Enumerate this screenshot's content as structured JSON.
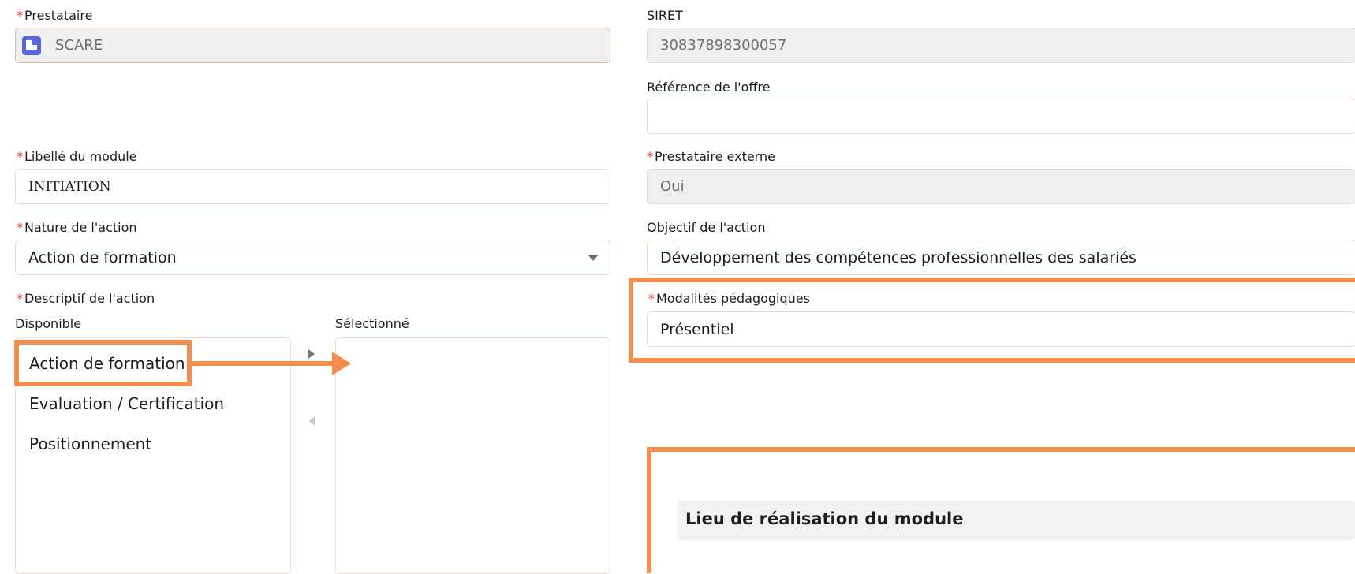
{
  "required_mark": "*",
  "prestataire": {
    "label": "Prestataire",
    "value": "SCARE",
    "icon": "building-icon"
  },
  "siret": {
    "label": "SIRET",
    "value": "30837898300057"
  },
  "reference_offre": {
    "label": "Référence de l'offre",
    "value": ""
  },
  "libelle_module": {
    "label": "Libellé du module",
    "value": "INITIATION"
  },
  "prestataire_externe": {
    "label": "Prestataire externe",
    "value": "Oui"
  },
  "nature_action": {
    "label": "Nature de l'action",
    "value": "Action de formation"
  },
  "objectif_action": {
    "label": "Objectif de l'action",
    "value": "Développement des compétences professionnelles des salariés"
  },
  "descriptif_action": {
    "label": "Descriptif de l'action",
    "available_label": "Disponible",
    "selected_label": "Sélectionné",
    "available": [
      "Action de formation",
      "Evaluation / Certification",
      "Positionnement"
    ],
    "selected": []
  },
  "modalites": {
    "label": "Modalités pédagogiques",
    "value": "Présentiel"
  },
  "lieu_section": {
    "title": "Lieu de réalisation du module"
  },
  "colors": {
    "highlight": "#f58d4c",
    "required": "#e5322d",
    "icon_bg": "#5868d9"
  }
}
